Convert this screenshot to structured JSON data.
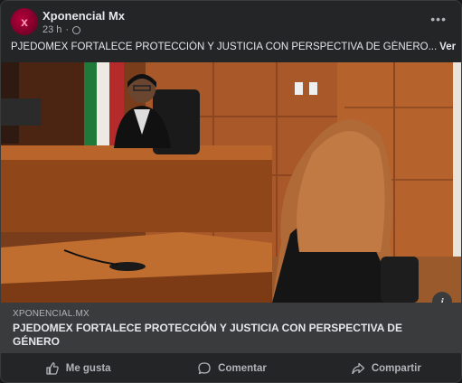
{
  "post": {
    "page_name": "Xponencial Mx",
    "avatar_letter": "x",
    "time": "23 h",
    "separator": "·",
    "more_label": "•••",
    "caption_text": "PJEDOMEX FORTALECE PROTECCIÓN Y JUSTICIA CON PERSPECTIVA DE GÉNERO...",
    "see_more": "Ver más"
  },
  "link_preview": {
    "domain": "XPONENCIAL.MX",
    "title": "PJEDOMEX FORTALECE PROTECCIÓN Y JUSTICIA CON PERSPECTIVA DE GÉNERO",
    "info_label": "i"
  },
  "actions": {
    "like": "Me gusta",
    "comment": "Comentar",
    "share": "Compartir"
  },
  "icons": {
    "avatar": "brand-logo-icon",
    "privacy": "globe-icon",
    "more": "more-options-icon",
    "info": "info-icon",
    "like": "thumbs-up-icon",
    "comment": "comment-bubble-icon",
    "share": "share-arrow-icon"
  },
  "colors": {
    "background": "#242526",
    "preview_background": "#3a3b3c",
    "text_primary": "#e4e6eb",
    "text_secondary": "#b0b3b8",
    "brand": "#b5003b"
  }
}
